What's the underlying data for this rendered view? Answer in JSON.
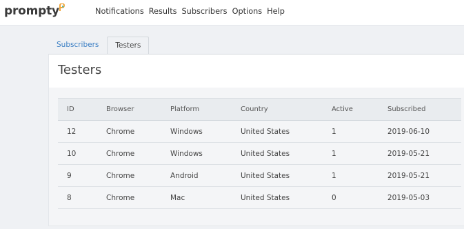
{
  "brand": {
    "name": "prompty",
    "accent": "#f0a53a"
  },
  "nav": [
    "Notifications",
    "Results",
    "Subscribers",
    "Options",
    "Help"
  ],
  "tabs": [
    {
      "label": "Subscribers",
      "active": false
    },
    {
      "label": "Testers",
      "active": true
    }
  ],
  "page": {
    "title": "Testers"
  },
  "table": {
    "headers": [
      "ID",
      "Browser",
      "Platform",
      "Country",
      "Active",
      "Subscribed"
    ],
    "rows": [
      [
        "12",
        "Chrome",
        "Windows",
        "United States",
        "1",
        "2019-06-10"
      ],
      [
        "10",
        "Chrome",
        "Windows",
        "United States",
        "1",
        "2019-05-21"
      ],
      [
        "9",
        "Chrome",
        "Android",
        "United States",
        "1",
        "2019-05-21"
      ],
      [
        "8",
        "Chrome",
        "Mac",
        "United States",
        "0",
        "2019-05-03"
      ]
    ]
  }
}
